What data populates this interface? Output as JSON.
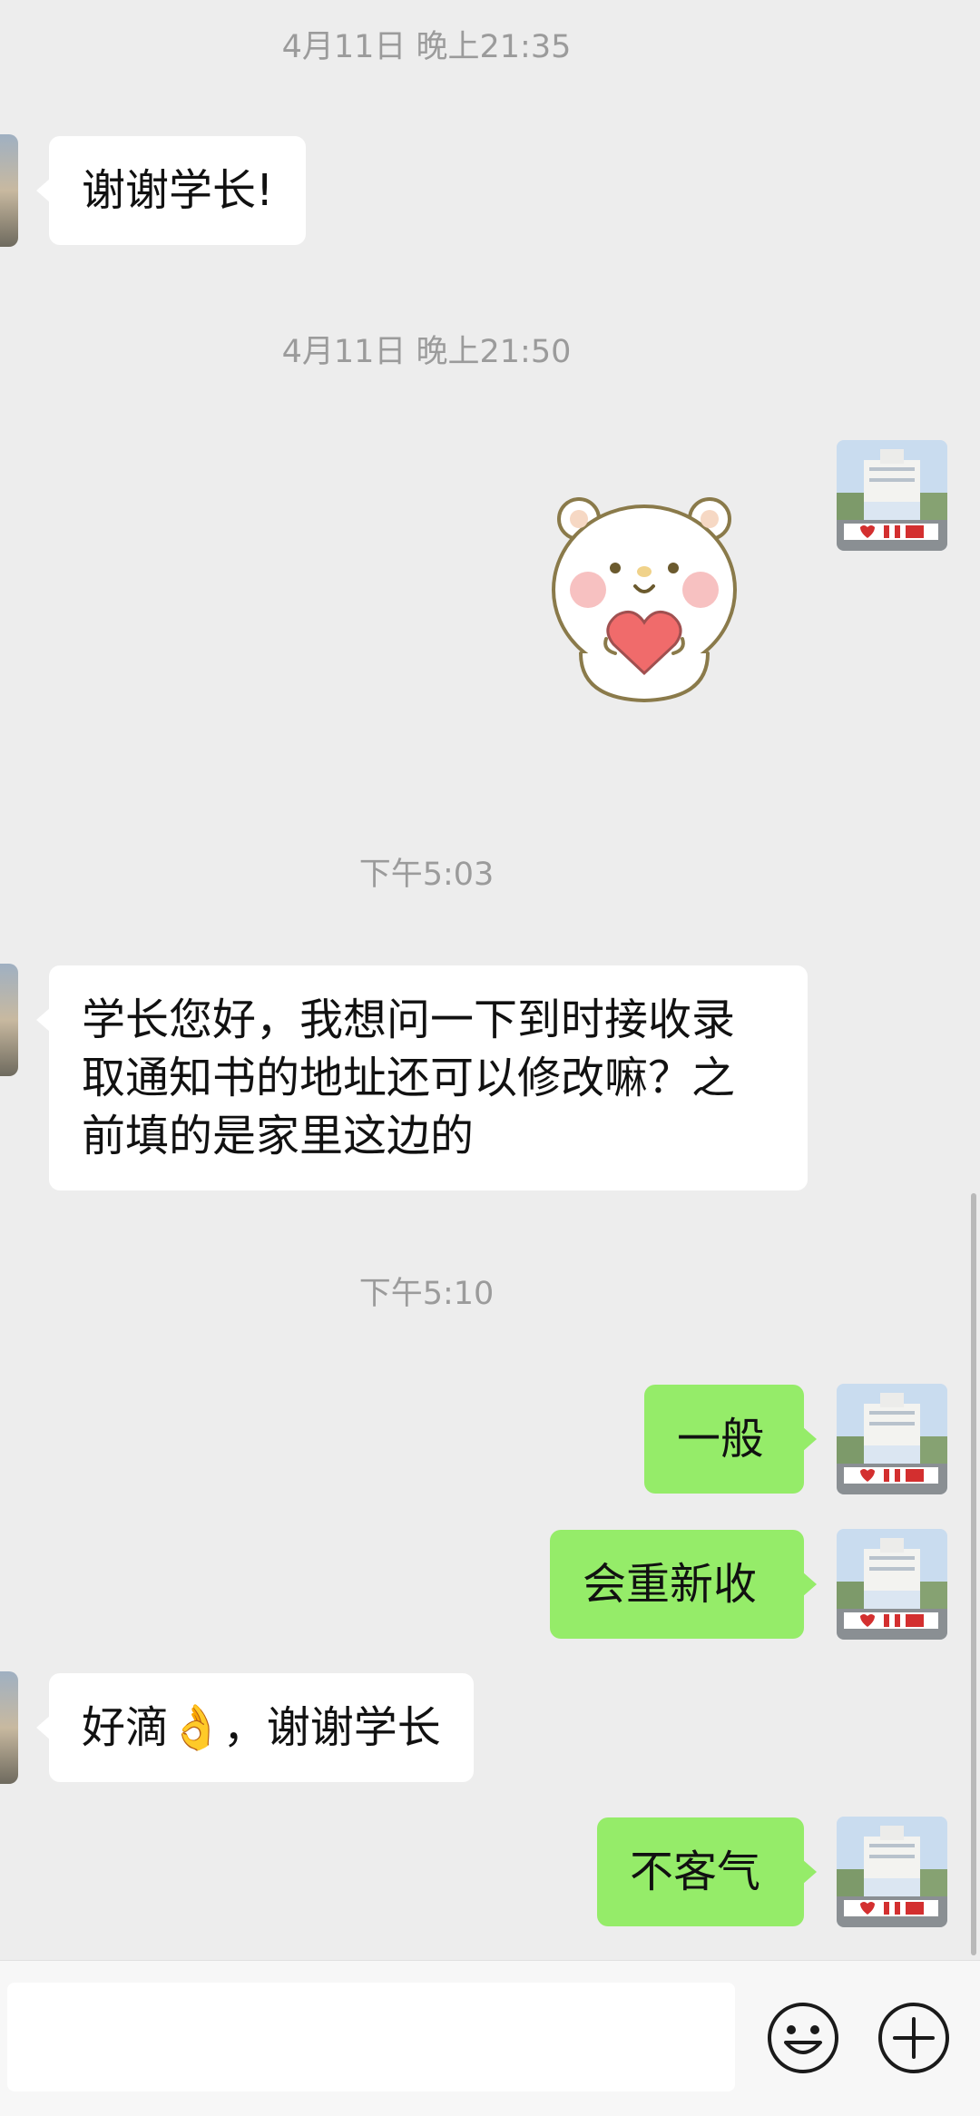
{
  "colors": {
    "background": "#ededed",
    "incoming_bubble": "#ffffff",
    "outgoing_bubble": "#95ec69",
    "timestamp_text": "#9b9b9b"
  },
  "timestamps": [
    "4月11日 晚上21:35",
    "4月11日 晚上21:50",
    "下午5:03",
    "下午5:10"
  ],
  "messages": {
    "m1": "谢谢学长!",
    "m2": "学长您好，我想问一下到时接收录\n取通知书的地址还可以修改嘛？之\n前填的是家里这边的",
    "m3": "一般",
    "m4": "会重新收",
    "m5_text": "好滴",
    "m5_emoji": "👌",
    "m5_tail": "，谢谢学长",
    "m6": "不客气"
  },
  "sticker": {
    "icon": "bear-heart-sticker"
  },
  "input_bar": {
    "value": "",
    "emoji_icon": "smiley-face-icon",
    "more_icon": "plus-circle-icon"
  }
}
